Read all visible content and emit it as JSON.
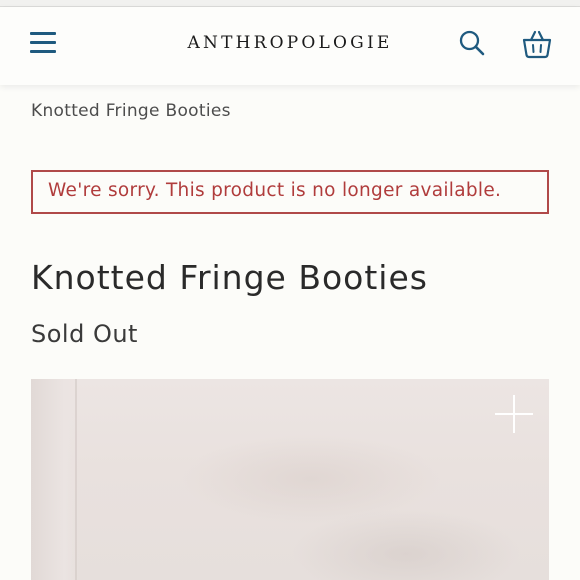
{
  "header": {
    "logo": "ANTHROPOLOGIE",
    "menu_icon": "hamburger-menu-icon",
    "search_icon": "search-icon",
    "bag_icon": "shopping-basket-icon",
    "accent_color": "#1f5a7f"
  },
  "breadcrumb": {
    "label": "Knotted Fringe Booties"
  },
  "alert": {
    "message": "We're sorry. This product is no longer available.",
    "color": "#b03c3c"
  },
  "product": {
    "title": "Knotted Fringe Booties",
    "status": "Sold Out",
    "zoom_icon": "plus-icon"
  }
}
